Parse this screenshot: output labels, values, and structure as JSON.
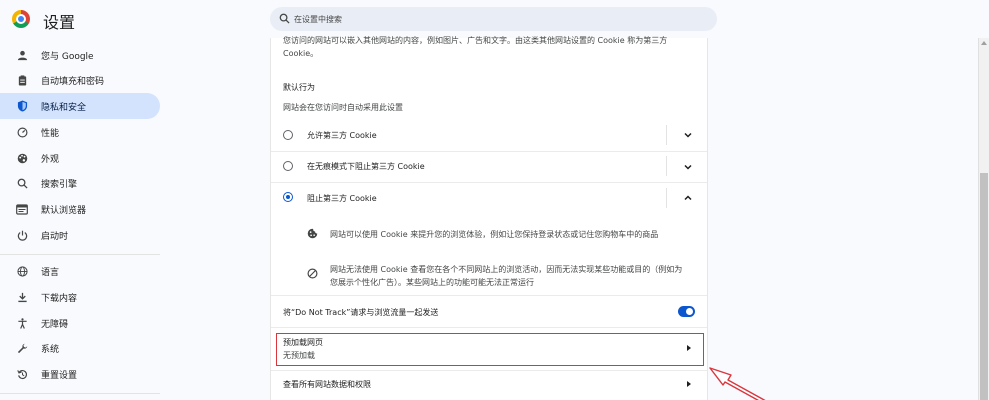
{
  "header": {
    "title": "设置",
    "search_placeholder": "在设置中搜索"
  },
  "sidebar": {
    "items": [
      {
        "label": "您与 Google",
        "icon": "person-icon"
      },
      {
        "label": "自动填充和密码",
        "icon": "clipboard-icon"
      },
      {
        "label": "隐私和安全",
        "icon": "shield-icon",
        "active": true
      },
      {
        "label": "性能",
        "icon": "speedometer-icon"
      },
      {
        "label": "外观",
        "icon": "palette-icon"
      },
      {
        "label": "搜索引擎",
        "icon": "search-icon"
      },
      {
        "label": "默认浏览器",
        "icon": "browser-icon"
      },
      {
        "label": "启动时",
        "icon": "power-icon"
      },
      {
        "label": "语言",
        "icon": "globe-icon"
      },
      {
        "label": "下载内容",
        "icon": "download-icon"
      },
      {
        "label": "无障碍",
        "icon": "accessibility-icon"
      },
      {
        "label": "系统",
        "icon": "wrench-icon"
      },
      {
        "label": "重置设置",
        "icon": "reset-icon"
      }
    ]
  },
  "content": {
    "intro_line1": "您访问的网站可以嵌入其他网站的内容，例如图片、广告和文字。由这类其他网站设置的 Cookie 称为第三方",
    "intro_line2": "Cookie。",
    "default_behavior_title": "默认行为",
    "default_behavior_desc": "网站会在您访问时自动采用此设置",
    "options": [
      {
        "label": "允许第三方 Cookie",
        "checked": false,
        "expanded": false
      },
      {
        "label": "在无痕模式下阻止第三方 Cookie",
        "checked": false,
        "expanded": false
      },
      {
        "label": "阻止第三方 Cookie",
        "checked": true,
        "expanded": true
      }
    ],
    "detail1": "网站可以使用 Cookie 来提升您的浏览体验，例如让您保持登录状态或记住您购物车中的商品",
    "detail2_line1": "网站无法使用 Cookie 查看您在各个不同网站上的浏览活动，因而无法实现某些功能或目的（例如为",
    "detail2_line2": "您展示个性化广告）。某些网站上的功能可能无法正常运行",
    "dnt_label": "将“Do Not Track”请求与浏览流量一起发送",
    "dnt_enabled": true,
    "preload_title": "预加载网页",
    "preload_value": "无预加载",
    "site_data_label": "查看所有网站数据和权限"
  },
  "colors": {
    "accent": "#0b57d0",
    "active_nav_bg": "#d3e3fd",
    "annotation_red": "#d9363e"
  }
}
